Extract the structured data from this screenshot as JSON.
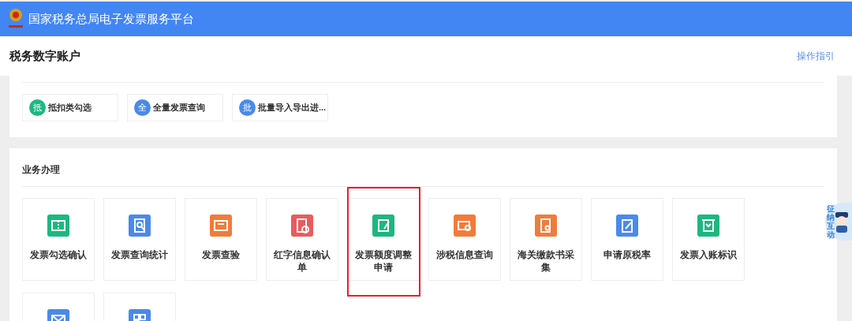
{
  "topbar": {
    "title": "国家税务总局电子发票服务平台"
  },
  "header": {
    "title": "税务数字账户",
    "guide_link": "操作指引"
  },
  "quick_actions": [
    {
      "badge": "抵",
      "label": "抵扣类勾选",
      "color": "#1db77f"
    },
    {
      "badge": "全",
      "label": "全量发票查询",
      "color": "#4a8ae8"
    },
    {
      "badge": "批",
      "label": "批量导入导出进...",
      "color": "#4a8ae8"
    }
  ],
  "business": {
    "title": "业务办理",
    "tiles": [
      {
        "label": "发票勾选确认",
        "color": "#1db77f",
        "highlighted": false
      },
      {
        "label": "发票查询统计",
        "color": "#4a8ae8",
        "highlighted": false
      },
      {
        "label": "发票查验",
        "color": "#f07c3a",
        "highlighted": false
      },
      {
        "label": "红字信息确认单",
        "color": "#e85c5c",
        "highlighted": false
      },
      {
        "label": "发票额度调整申请",
        "color": "#1db77f",
        "highlighted": true
      },
      {
        "label": "涉税信息查询",
        "color": "#f07c3a",
        "highlighted": false
      },
      {
        "label": "海关缴款书采集",
        "color": "#f07c3a",
        "highlighted": false
      },
      {
        "label": "申请原税率",
        "color": "#4a8ae8",
        "highlighted": false
      },
      {
        "label": "发票入账标识",
        "color": "#1db77f",
        "highlighted": false
      },
      {
        "color": "#4a8ae8",
        "highlighted": false
      },
      {
        "color": "#4a8ae8",
        "highlighted": false
      }
    ]
  },
  "assistant": {
    "label": "征纳互动"
  }
}
